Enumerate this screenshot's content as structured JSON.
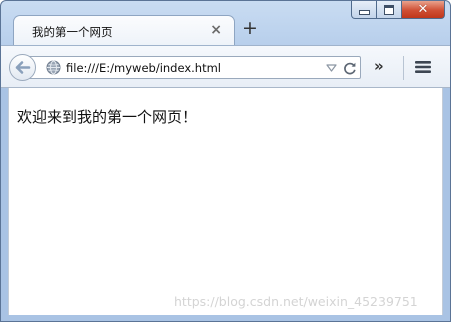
{
  "tab": {
    "title": "我的第一个网页",
    "close_glyph": "×"
  },
  "new_tab_glyph": "+",
  "window_controls": {
    "close_glyph": "✕"
  },
  "address_bar": {
    "url": "file:///E:/myweb/index.html",
    "site_icon": "globe-icon"
  },
  "toolbar": {
    "overflow_glyph": "»",
    "menu_icon": "hamburger-icon",
    "back_icon": "back-arrow-icon",
    "reload_icon": "reload-icon"
  },
  "page": {
    "heading_text": "欢迎来到我的第一个网页！"
  },
  "watermark": "https://blog.csdn.net/weixin_45239751",
  "colors": {
    "chrome": "#b9d0ec",
    "close_button": "#cf4f34",
    "back_arrow": "#8aa0bb"
  }
}
